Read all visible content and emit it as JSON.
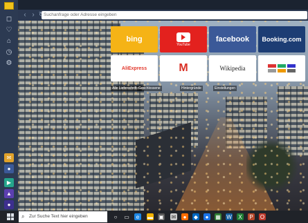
{
  "browser": {
    "address_placeholder": "Suchanfrage oder Adresse eingeben"
  },
  "speed_dial": {
    "tiles": [
      {
        "name": "bing",
        "sub": ""
      },
      {
        "name": "",
        "sub": "YouTube"
      },
      {
        "name": "facebook",
        "sub": ""
      },
      {
        "name": "Booking.com",
        "sub": ""
      },
      {
        "name": "AliExpress",
        "sub": ""
      },
      {
        "name": "M",
        "sub": ""
      },
      {
        "name": "Wikipedia",
        "sub": ""
      },
      {
        "name": "",
        "sub": ""
      }
    ],
    "labels": [
      "Alle Lieferschriften",
      "Geschlossene",
      "Hintergründe",
      "Einstellungen"
    ]
  },
  "taskbar": {
    "search_placeholder": "Zur Suche Text hier eingeben"
  },
  "colors": {
    "bing": "#f5b316",
    "youtube": "#e3211e",
    "facebook": "#3b5998",
    "booking": "#1d3d74"
  }
}
